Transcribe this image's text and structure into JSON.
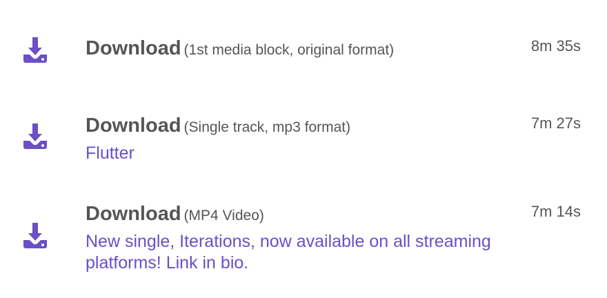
{
  "accent_color": "#6a4fc7",
  "items": [
    {
      "icon": "download-icon",
      "title": "Download",
      "format": "(1st media block, original format)",
      "duration": "8m 35s",
      "description": ""
    },
    {
      "icon": "download-icon",
      "title": "Download",
      "format": "(Single track, mp3 format)",
      "duration": "7m 27s",
      "description": "Flutter"
    },
    {
      "icon": "download-icon",
      "title": "Download",
      "format": "(MP4 Video)",
      "duration": "7m 14s",
      "description": "New single, Iterations, now available on all streaming platforms! Link in bio."
    }
  ]
}
